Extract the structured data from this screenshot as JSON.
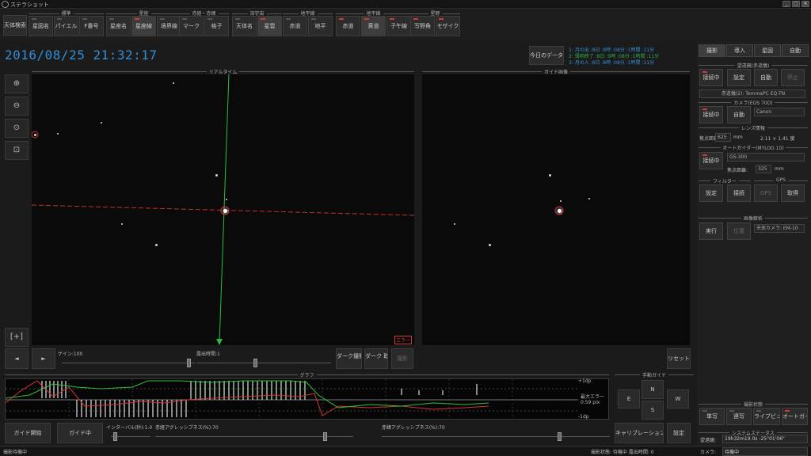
{
  "window": {
    "title": "ステラショット",
    "min": "_",
    "max": "□",
    "close": "×"
  },
  "toolbar": {
    "mount_button": "天体検索",
    "groups": [
      {
        "label": "標準",
        "buttons": [
          "星図名",
          "パイエル",
          "F番号"
        ]
      },
      {
        "label": "星座",
        "buttons": [
          "星座名",
          "星座線",
          "境界線"
        ]
      },
      {
        "label": "赤経・赤緯",
        "buttons": [
          "マーク",
          "格子"
        ]
      },
      {
        "label": "深宇宙",
        "buttons": [
          "天体名",
          "星雲"
        ]
      },
      {
        "label": "地平線",
        "buttons": [
          "赤道",
          "地平"
        ]
      },
      {
        "label": "地平線",
        "buttons": [
          "赤道",
          "黄道",
          "子午線"
        ]
      },
      {
        "label": "星野",
        "buttons": [
          "写野角",
          "モザイク"
        ]
      }
    ]
  },
  "datetime": "2016/08/25 21:32:17",
  "today_button": "今日のデータ",
  "ephemeris": [
    "1:  月の出  :8日  :8時  :08分  :1時間  :11分",
    "2:  薄明終了 :8日  :9時  :08分  :1時間  :11分",
    "3:  月の入  :8日  :8時  :08分  :1時間  :11分"
  ],
  "views": {
    "live_label": "リアルタイム",
    "guide_label": "ガイド画像"
  },
  "live_controls": {
    "gain_label": "ゲイン:100",
    "exposure_label": "露出時間:1",
    "dark_button": "ダーク撮影 開始",
    "flat_button": "ダーク 取得",
    "capture_button": "撮影",
    "reset_button": "リセット",
    "frame_btn": "[+]",
    "prev_btn": "◄",
    "next_btn": "►",
    "error_badge": "エラー"
  },
  "graph": {
    "label": "グラフ",
    "upper_label": "+1dp",
    "lower_label": "-1dp",
    "rms_label": "最大エラー 0.59 pix",
    "rms_unit": "0.000 : 0.10pix"
  },
  "guide_controls": {
    "label": "手動ガイド",
    "n": "N",
    "s": "S",
    "e": "E",
    "w": "W",
    "start_button": "ガイド開始",
    "guide_button": "ガイド中",
    "interval_label": "インターバル(秒):1.0",
    "ra_label": "赤経アグレッシブネス(%):70",
    "dec_label": "赤緯アグレッシブネス(%):70",
    "calibration_button": "キャリブレーション",
    "settings_button": "設定"
  },
  "right_panel": {
    "tabs": [
      "撮影",
      "導入",
      "星図",
      "自動"
    ],
    "sec_mount": "望遠鏡(赤道儀)",
    "mount_buttons": [
      "接続中",
      "設定",
      "自動",
      "停止"
    ],
    "mount_model": "赤道儀(2): TemmaPC EQ-TN",
    "sec_camera": "カメラ(EOS 70D)",
    "camera_buttons": [
      "接続中",
      "自動"
    ],
    "camera_select": "Canon",
    "sec_lens": "レンズ情報",
    "focal_label": "焦点距離:",
    "focal_value": "625",
    "focal_unit": "mm",
    "fov": "2.11 × 1.41 度",
    "sec_autoguider": "オートガイダー(MYLOG 10)",
    "ag_button": "接続中",
    "ag_select": "GS-300",
    "ag_focal_label": "焦点距離:",
    "ag_focal_value": "325",
    "ag_focal_unit": "mm",
    "sec_filter": "フィルター",
    "sec_gps": "GPS",
    "filter_buttons": [
      "設定",
      "接続"
    ],
    "gps_buttons": [
      "GPS",
      "取得"
    ],
    "sec_plate": "画像解析",
    "plate_buttons": [
      "実行",
      "位置"
    ],
    "plate_select": "天体カメラ: EM-10",
    "sec_status": "撮影状態",
    "status_buttons": [
      "単写",
      "連写",
      "ライブビュー",
      "オートガイド"
    ],
    "sec_system": "システムステータス",
    "telescope_label": "望遠鏡:",
    "telescope_value": "19h32m19.0s   -25°01'06\"",
    "camera_label": "カメラ:",
    "camera_value": "待機中"
  },
  "statusbar": {
    "left": "撮影待機中",
    "right": "撮影状態: 待機中  露出時間: 0"
  },
  "chart_colors": {
    "ra": "#d83232",
    "dec": "#2fbf3f",
    "guide": "#e0e0e0",
    "accent": "#2f8fd8"
  }
}
